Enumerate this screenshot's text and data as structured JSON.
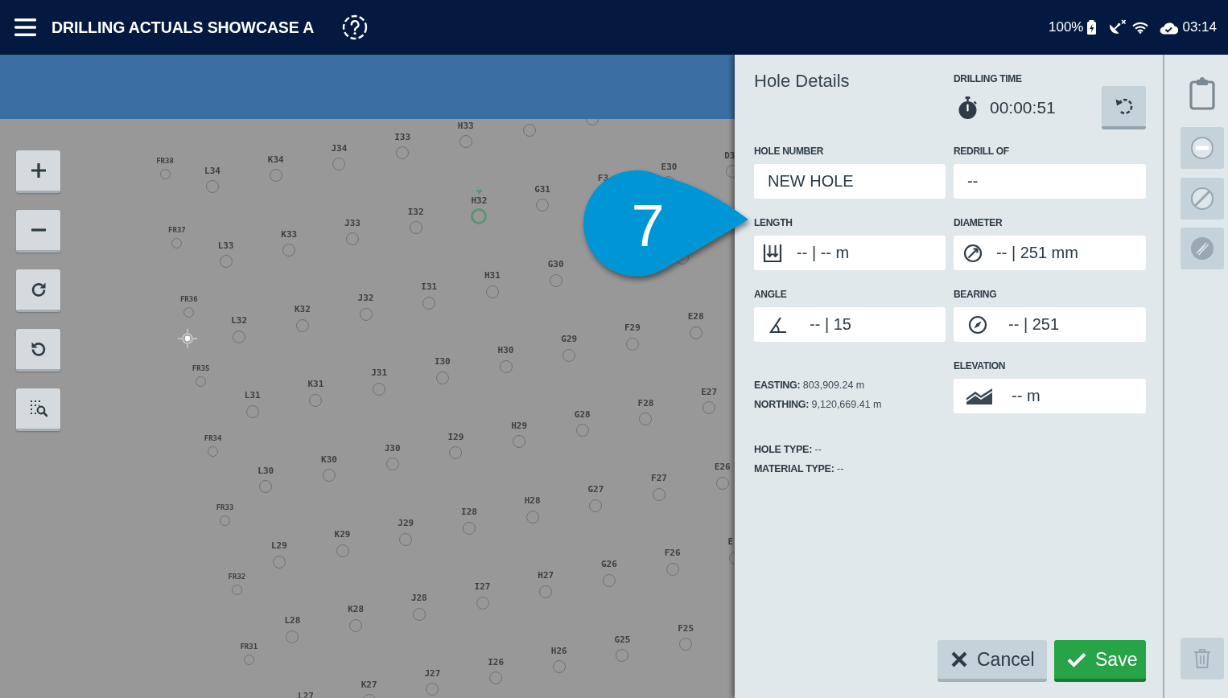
{
  "header": {
    "title": "DRILLING ACTUALS SHOWCASE A",
    "battery": "100%",
    "time": "03:14"
  },
  "map": {
    "grid_rows": [
      [
        {
          "kind": "hole",
          "label": "L34",
          "selected": false
        },
        {
          "kind": "hole",
          "label": "K34",
          "selected": false
        },
        {
          "kind": "hole",
          "label": "J34",
          "selected": false
        },
        {
          "kind": "hole",
          "label": "I33",
          "selected": false
        },
        {
          "kind": "hole",
          "label": "H33",
          "selected": false
        },
        {
          "kind": "hole",
          "selected": false
        },
        {
          "kind": "hole",
          "selected": false
        }
      ],
      [
        {
          "kind": "hole",
          "label": "L33",
          "selected": false
        },
        {
          "kind": "hole",
          "label": "K33",
          "selected": false
        },
        {
          "kind": "hole",
          "label": "J33",
          "selected": false
        },
        {
          "kind": "hole",
          "label": "I32",
          "selected": false
        },
        {
          "kind": "hole",
          "label": "H32",
          "selected": true
        },
        {
          "kind": "hole",
          "label": "G31",
          "selected": false
        },
        {
          "kind": "label",
          "label": "F3",
          "selected": false
        },
        {
          "kind": "hole",
          "label": "E30",
          "selected": false
        },
        {
          "kind": "hole",
          "label": "D3",
          "selected": false
        }
      ],
      [
        {
          "kind": "hole",
          "label": "L32",
          "selected": false
        },
        {
          "kind": "hole",
          "label": "K32",
          "selected": false
        },
        {
          "kind": "hole",
          "label": "J32",
          "selected": false
        },
        {
          "kind": "hole",
          "label": "I31",
          "selected": false
        },
        {
          "kind": "hole",
          "label": "H31",
          "selected": false
        },
        {
          "kind": "hole",
          "label": "G30",
          "selected": false
        },
        null,
        {
          "kind": "hole",
          "selected": false
        }
      ],
      [
        {
          "kind": "hole",
          "label": "L31",
          "selected": false
        },
        {
          "kind": "hole",
          "label": "K31",
          "selected": false
        },
        {
          "kind": "hole",
          "label": "J31",
          "selected": false
        },
        {
          "kind": "hole",
          "label": "I30",
          "selected": false
        },
        {
          "kind": "hole",
          "label": "H30",
          "selected": false
        },
        {
          "kind": "hole",
          "label": "G29",
          "selected": false
        },
        {
          "kind": "hole",
          "label": "F29",
          "selected": false
        },
        {
          "kind": "hole",
          "label": "E28",
          "selected": false
        }
      ],
      [
        {
          "kind": "hole",
          "label": "L30",
          "selected": false
        },
        {
          "kind": "hole",
          "label": "K30",
          "selected": false
        },
        {
          "kind": "hole",
          "label": "J30",
          "selected": false
        },
        {
          "kind": "hole",
          "label": "I29",
          "selected": false
        },
        {
          "kind": "hole",
          "label": "H29",
          "selected": false
        },
        {
          "kind": "hole",
          "label": "G28",
          "selected": false
        },
        {
          "kind": "hole",
          "label": "F28",
          "selected": false
        },
        {
          "kind": "hole",
          "label": "E27",
          "selected": false
        }
      ],
      [
        {
          "kind": "hole",
          "label": "L29",
          "selected": false
        },
        {
          "kind": "hole",
          "label": "K29",
          "selected": false
        },
        {
          "kind": "hole",
          "label": "J29",
          "selected": false
        },
        {
          "kind": "hole",
          "label": "I28",
          "selected": false
        },
        {
          "kind": "hole",
          "label": "H28",
          "selected": false
        },
        {
          "kind": "hole",
          "label": "G27",
          "selected": false
        },
        {
          "kind": "hole",
          "label": "F27",
          "selected": false
        },
        {
          "kind": "hole",
          "label": "E26",
          "selected": false
        }
      ],
      [
        {
          "kind": "hole",
          "label": "L28",
          "selected": false
        },
        {
          "kind": "hole",
          "label": "K28",
          "selected": false
        },
        {
          "kind": "hole",
          "label": "J28",
          "selected": false
        },
        {
          "kind": "hole",
          "label": "I27",
          "selected": false
        },
        {
          "kind": "hole",
          "label": "H27",
          "selected": false
        },
        {
          "kind": "hole",
          "label": "G26",
          "selected": false
        },
        {
          "kind": "hole",
          "label": "F26",
          "selected": false
        },
        {
          "kind": "hole",
          "label": "E",
          "selected": false
        }
      ],
      [
        {
          "kind": "label",
          "label": "L27",
          "selected": false
        },
        {
          "kind": "hole",
          "label": "K27",
          "selected": false
        },
        {
          "kind": "hole",
          "label": "J27",
          "selected": false
        },
        {
          "kind": "hole",
          "label": "I26",
          "selected": false
        },
        {
          "kind": "hole",
          "label": "H26",
          "selected": false
        },
        {
          "kind": "hole",
          "label": "G25",
          "selected": false
        },
        {
          "kind": "hole",
          "label": "F25",
          "selected": false
        }
      ]
    ],
    "front_row": [
      {
        "kind": "hole",
        "label": "FR38",
        "selected": false
      },
      {
        "kind": "hole",
        "label": "FR37",
        "selected": false
      },
      {
        "kind": "hole",
        "label": "FR36",
        "selected": false
      },
      {
        "kind": "hole",
        "label": "FR35",
        "selected": false
      },
      {
        "kind": "hole",
        "label": "FR34",
        "selected": false
      },
      {
        "kind": "hole",
        "label": "FR33",
        "selected": false
      },
      {
        "kind": "hole",
        "label": "FR32",
        "selected": false
      },
      {
        "kind": "hole",
        "label": "FR31",
        "selected": false
      }
    ]
  },
  "hole_details": {
    "title": "Hole Details",
    "drilling_time": {
      "label": "DRILLING TIME",
      "value": "00:00:51"
    },
    "fields": [
      {
        "kind": "text",
        "label": "HOLE NUMBER",
        "value": "NEW HOLE"
      },
      {
        "kind": "text",
        "label": "REDRILL OF",
        "value": "--"
      },
      {
        "kind": "length",
        "label": "LENGTH",
        "value": "-- | -- m"
      },
      {
        "kind": "diameter",
        "label": "DIAMETER",
        "value": "-- | 251 mm"
      },
      {
        "kind": "angle",
        "label": "ANGLE",
        "value": "-- | 15"
      },
      {
        "kind": "bearing",
        "label": "BEARING",
        "value": "-- | 251"
      },
      {
        "kind": "elevation",
        "label": "ELEVATION",
        "value": "-- m"
      }
    ],
    "coordinates": [
      "**EASTING:** 803,909.24 m",
      "**NORTHING:** 9,120,669.41 m"
    ],
    "types": [
      "**HOLE TYPE:** --",
      "**MATERIAL TYPE:** --"
    ],
    "buttons": [
      {
        "kind": "cancel",
        "label": "Cancel"
      },
      {
        "kind": "save",
        "label": "Save"
      }
    ]
  },
  "side_tools": [
    {
      "kind": "clipboard"
    },
    {
      "kind": "minus",
      "disabled": true
    },
    {
      "kind": "slash",
      "disabled": true
    },
    {
      "kind": "strike",
      "disabled": true
    },
    {
      "kind": "trash",
      "disabled": true
    }
  ],
  "callout": {
    "number": "7"
  }
}
